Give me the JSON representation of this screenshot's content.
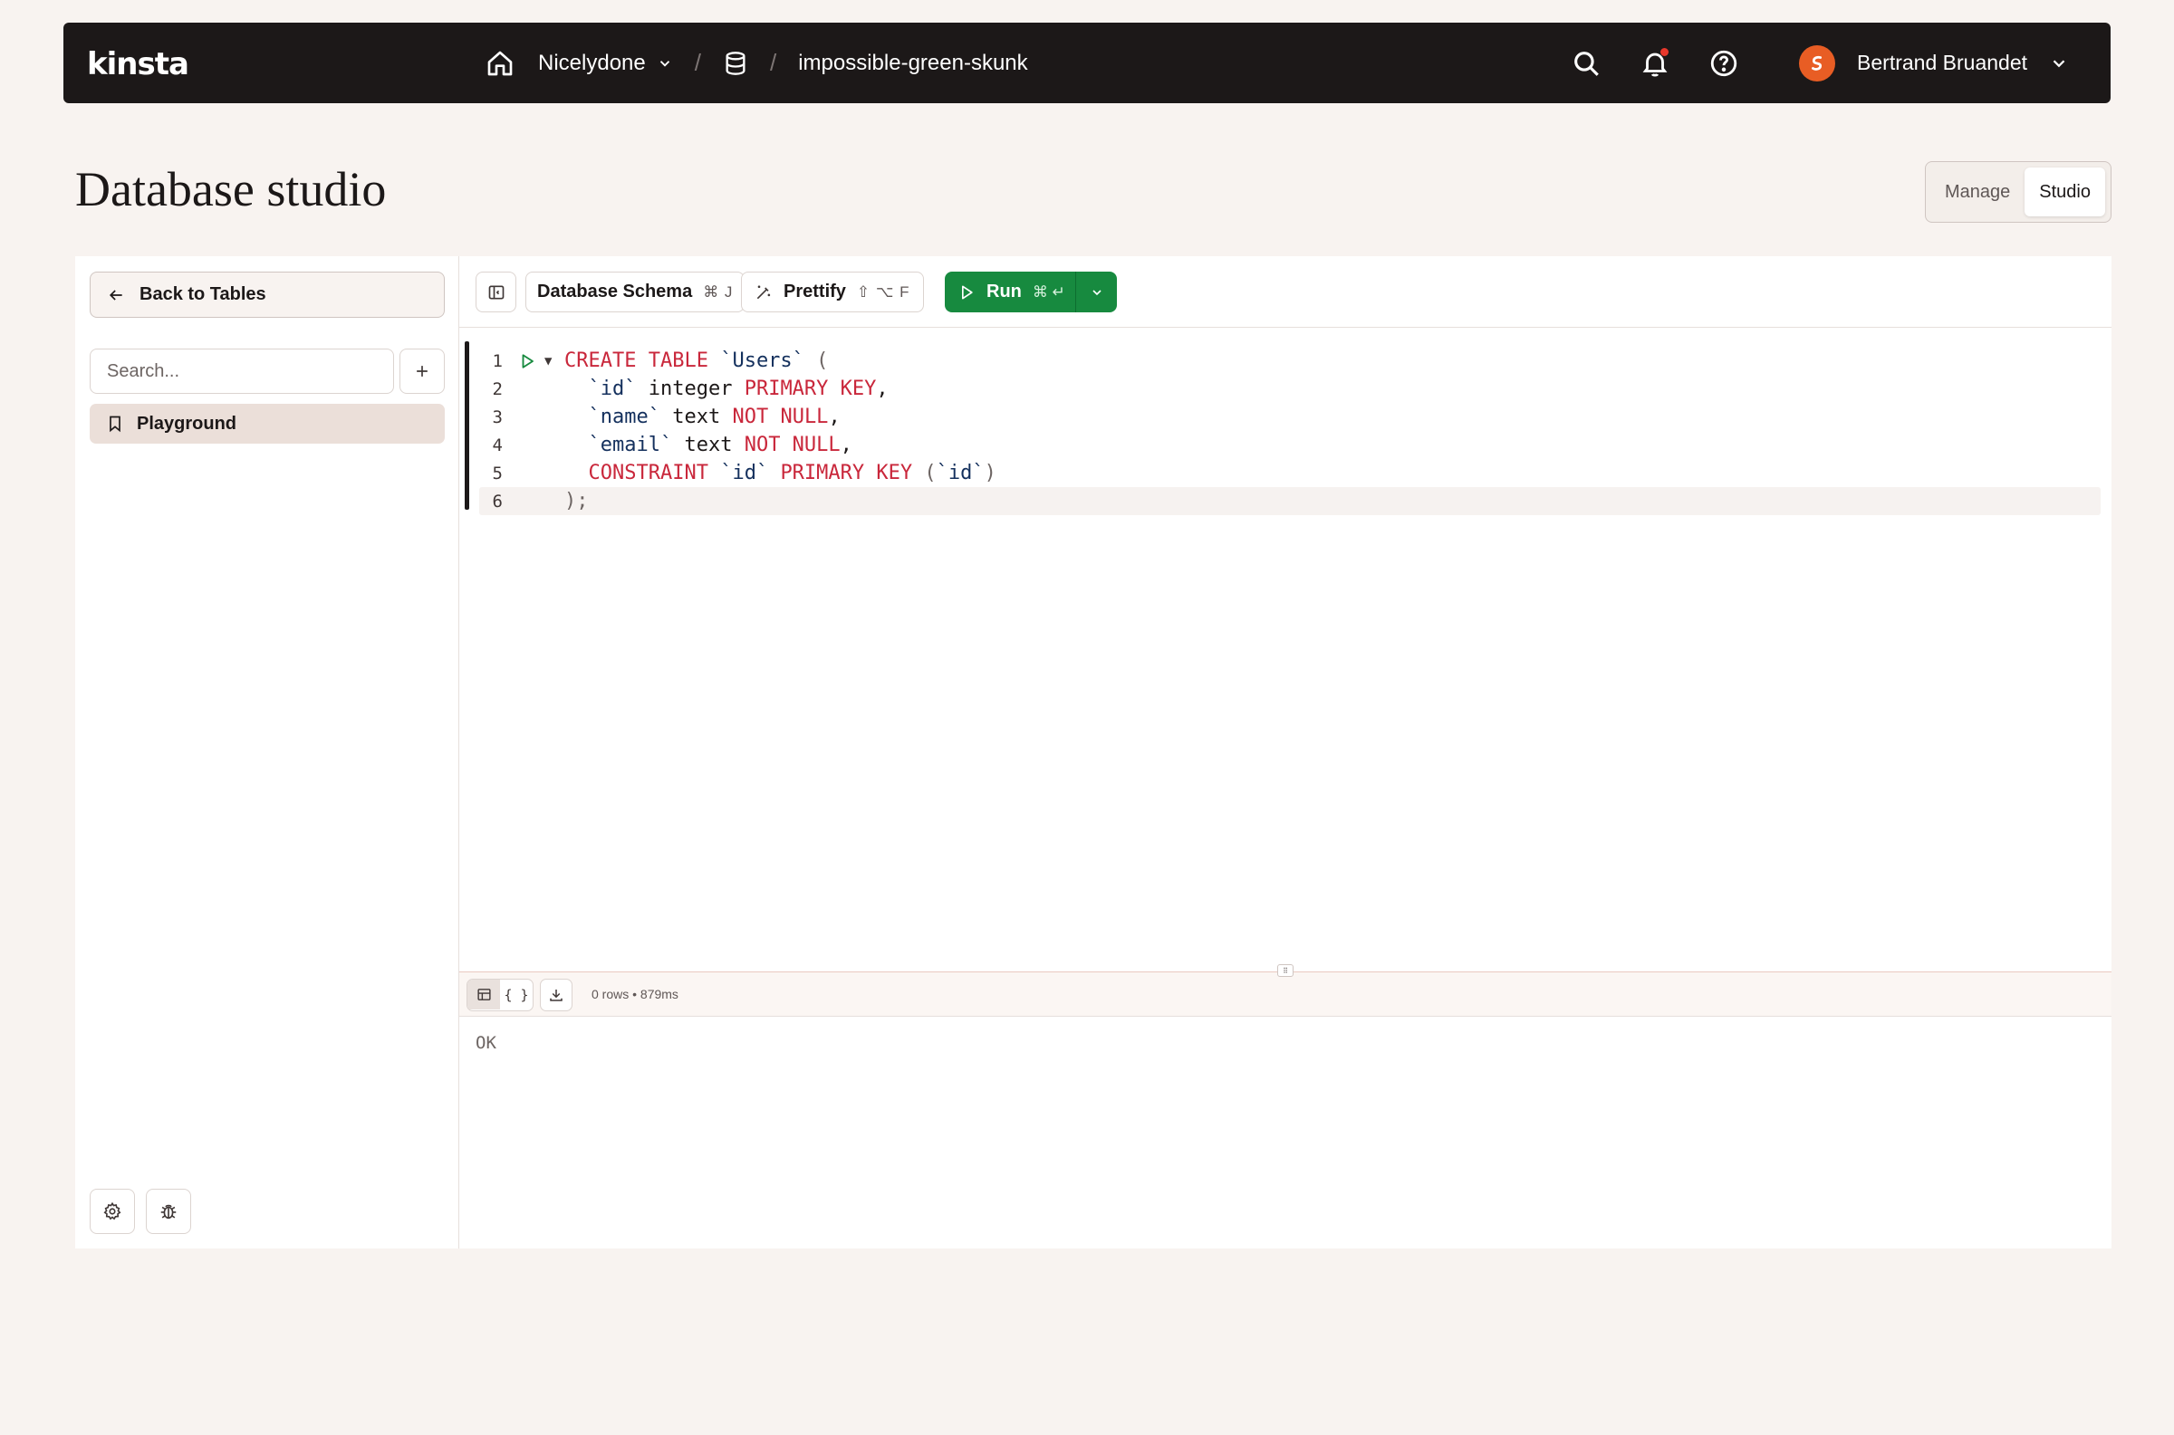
{
  "app": {
    "logo": "kinsta"
  },
  "topbar": {
    "breadcrumb": {
      "company": "Nicelydone",
      "database": "impossible-green-skunk"
    },
    "user": {
      "name": "Bertrand Bruandet"
    },
    "icons": [
      "home-icon",
      "chevron-down-icon",
      "database-icon",
      "search-icon",
      "bell-icon",
      "help-icon",
      "chevron-down-icon"
    ]
  },
  "page": {
    "title": "Database studio",
    "mode_tabs": [
      "Manage",
      "Studio"
    ],
    "active_mode": "Studio"
  },
  "sidebar": {
    "back_label": "Back to Tables",
    "search_placeholder": "Search...",
    "items": [
      {
        "label": "Playground",
        "icon": "bookmark-icon",
        "selected": true
      }
    ]
  },
  "toolbar": {
    "schema_label": "Database Schema",
    "schema_shortcut": "⌘ J",
    "prettify_label": "Prettify",
    "prettify_shortcut": "⇧ ⌥ F",
    "run_label": "Run",
    "run_shortcut": "⌘ ↵"
  },
  "editor": {
    "lines": [
      {
        "num": "1",
        "text": "CREATE TABLE `Users` ("
      },
      {
        "num": "2",
        "text": "  `id` integer PRIMARY KEY,"
      },
      {
        "num": "3",
        "text": "  `name` text NOT NULL,"
      },
      {
        "num": "4",
        "text": "  `email` text NOT NULL,"
      },
      {
        "num": "5",
        "text": "  CONSTRAINT `id` PRIMARY KEY (`id`)"
      },
      {
        "num": "6",
        "text": ");"
      }
    ]
  },
  "results": {
    "stats": "0 rows • 879ms",
    "output": "OK"
  },
  "colors": {
    "topbar_bg": "#1c1818",
    "run_green": "#178a3f",
    "keyword_red": "#c9273b",
    "identifier_navy": "#14305d",
    "page_bg": "#f8f3f0"
  }
}
